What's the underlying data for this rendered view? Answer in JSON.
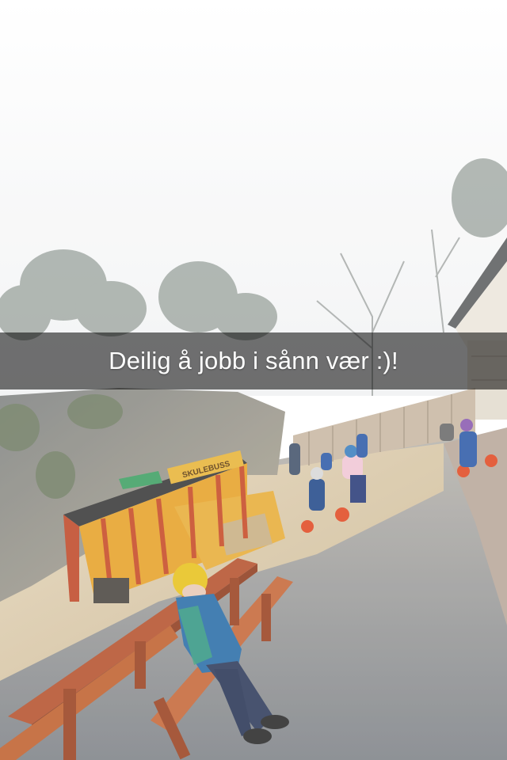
{
  "snap": {
    "caption": "Deilig å jobb i sånn vær :)!",
    "bus_sign": "SKULEBUSS"
  },
  "colors": {
    "sky": "#fbfbfb",
    "gravel": "#9a9ea3",
    "sand": "#d9c7a6",
    "bench_wood": "#b5532e",
    "bus_yellow": "#e6a22a",
    "bus_red": "#c64a26",
    "hat_yellow": "#e8c21e",
    "jacket_blue": "#2b6ea8",
    "caption_bar": "rgba(0,0,0,0.55)"
  }
}
